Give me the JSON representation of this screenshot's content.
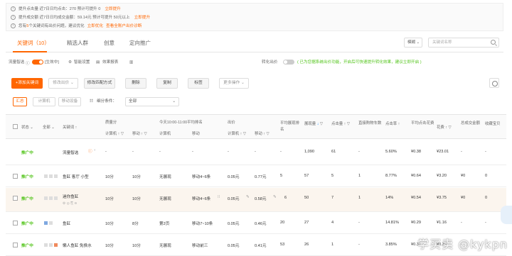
{
  "notice": {
    "line1": "提升点击量 近7日日均点击：270   预计可提升 0",
    "line1_link": "立即提升",
    "line2": "提升成交额 近7日日均成交金额：59.14元   预计可提升 50元以上",
    "line2_link": "立即提升",
    "line3_pre": "您有",
    "line3_count": "5",
    "line3_post": "个关键词有出价问题，建议优化",
    "line3_link1": "立即优化",
    "line3_link2": "查看全账户出价诊断"
  },
  "tabs": {
    "items": [
      "关键词（10）",
      "精选人群",
      "创意",
      "定向推广"
    ],
    "dropdown": "模糊",
    "search_placeholder": "关键词名称"
  },
  "options": {
    "traffic_label": "流量智选",
    "traffic_state": "[生效中]",
    "traffic_setting": "智能设置",
    "traffic_report": "效果报表",
    "convert_label": "转化出价",
    "convert_hint": "( 已为您据系统出价功能，开启后可快速提升转化效果，建议立即开启 )"
  },
  "toolbar": {
    "add": "+添加关键词",
    "modify_bid": "修改出价",
    "modify_match": "修改匹配方式",
    "delete": "删除",
    "copy": "复制",
    "tag": "标签",
    "more": "更多操作"
  },
  "filters": {
    "summary": "汇总",
    "computer": "计算机",
    "mobile": "移动设备",
    "condition_label": "细分条件：",
    "condition_value": "全部"
  },
  "headers": {
    "status": "状态",
    "all": "全部",
    "keyword": "关键词",
    "quality": "质量分",
    "qs_pc": "计算机",
    "qs_mobile": "移动",
    "rank_group": "今天10:00-11:00平均排名",
    "rank_pc": "计算机",
    "rank_mobile": "移动",
    "bid_group": "出价",
    "bid_pc": "计算机",
    "bid_mobile": "移动",
    "avg_rank": "平均展现排名",
    "impressions": "展现量",
    "clicks": "点击量",
    "direct_buy": "直接购物车数",
    "ctr": "点击率",
    "avg_cpc": "平均点击花费",
    "cost": "花费",
    "gmv": "总成交金额",
    "collect": "收藏宝贝"
  },
  "rows": [
    {
      "status": "推广中",
      "keyword": "流量智选",
      "checkbox": false,
      "qs_pc": "-",
      "qs_mobile": "-",
      "rank_pc": "-",
      "rank_mobile": "-",
      "bid_pc": "-",
      "bid_mobile": "-",
      "avg_rank": "-",
      "impressions": "1,090",
      "clicks": "61",
      "direct": "-",
      "ctr": "5.60%",
      "cpc": "¥0.38",
      "cost": "¥23.01",
      "gmv": "-",
      "collect": "-"
    },
    {
      "status": "推广中",
      "keyword": "鱼缸 客厅 小型",
      "checkbox": true,
      "qs_pc": "10分",
      "qs_mobile": "10分",
      "rank_pc": "无展现",
      "rank_mobile": "移动4~6条",
      "bid_pc": "0.05元",
      "bid_mobile": "0.77元",
      "avg_rank": "5",
      "impressions": "57",
      "clicks": "5",
      "direct": "1",
      "ctr": "8.77%",
      "cpc": "¥0.64",
      "cost": "¥3.20",
      "gmv": "¥0",
      "collect": "0"
    },
    {
      "status": "推广中",
      "keyword": "迷你鱼缸",
      "checkbox": true,
      "qs_pc": "10分",
      "qs_mobile": "10分",
      "rank_pc": "无展现",
      "rank_mobile": "移动4~6条",
      "bid_pc": "0.05元",
      "bid_mobile": "0.58元",
      "avg_rank": "6",
      "impressions": "50",
      "clicks": "7",
      "direct": "1",
      "ctr": "14%",
      "cpc": "¥0.54",
      "cost": "¥3.75",
      "gmv": "¥0",
      "collect": "0"
    },
    {
      "status": "推广中",
      "keyword": "鱼缸",
      "checkbox": true,
      "qs_pc": "10分",
      "qs_mobile": "8分",
      "rank_pc": "第2页",
      "rank_mobile": "移动7~10条",
      "bid_pc": "0.05元",
      "bid_mobile": "0.46元",
      "avg_rank": "20",
      "impressions": "27",
      "clicks": "4",
      "direct": "-",
      "ctr": "14.81%",
      "cpc": "¥0.29",
      "cost": "¥1.16",
      "gmv": "-",
      "collect": "-"
    },
    {
      "status": "推广中",
      "keyword": "懒人鱼缸 免换水",
      "checkbox": true,
      "qs_pc": "10分",
      "qs_mobile": "10分",
      "rank_pc": "无展现",
      "rank_mobile": "移动前三",
      "bid_pc": "0.05元",
      "bid_mobile": "0.41元",
      "avg_rank": "53",
      "impressions": "26",
      "clicks": "1",
      "direct": "-",
      "ctr": "3.85%",
      "cpc": "¥0.37",
      "cost": "¥0.37",
      "gmv": "-",
      "collect": "-"
    }
  ],
  "watermark": "学买卖 @kykpn",
  "colors": {
    "accent": "#ff6600",
    "status": "#52c41a"
  }
}
